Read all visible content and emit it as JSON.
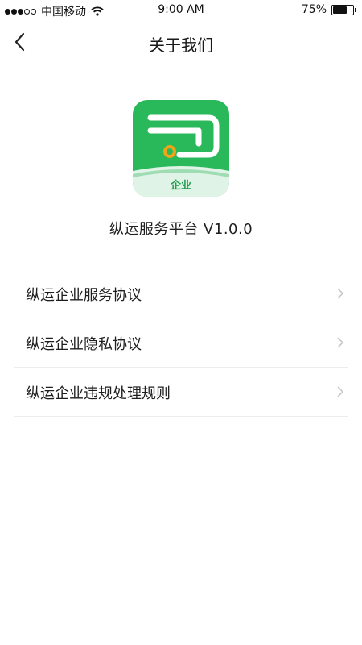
{
  "status_bar": {
    "carrier": "中国移动",
    "time": "9:00 AM",
    "battery_percent": "75%",
    "battery_level": 0.75
  },
  "nav": {
    "title": "关于我们",
    "back_icon": "chevron-left-icon"
  },
  "logo": {
    "badge_text": "企业",
    "brand_color": "#29b85a"
  },
  "app": {
    "name_version": "纵运服务平台 V1.0.0"
  },
  "menu": {
    "items": [
      {
        "label": "纵运企业服务协议"
      },
      {
        "label": "纵运企业隐私协议"
      },
      {
        "label": "纵运企业违规处理规则"
      }
    ]
  }
}
